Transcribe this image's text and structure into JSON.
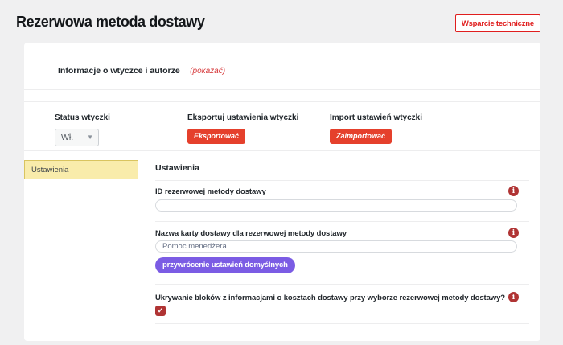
{
  "page": {
    "title": "Rezerwowa metoda dostawy",
    "support_button_label": "Wsparcie techniczne"
  },
  "info_section": {
    "label": "Informacje o wtyczce i autorze",
    "toggle_link_label": "(pokazać)"
  },
  "status_section": {
    "status_label": "Status wtyczki",
    "status_value": "Wł.",
    "export_label": "Eksportuj ustawienia wtyczki",
    "export_button_label": "Eksportować",
    "import_label": "Import ustawień wtyczki",
    "import_button_label": "Zaimportować"
  },
  "sidebar": {
    "tabs": [
      {
        "label": "Ustawienia",
        "active": true
      }
    ]
  },
  "settings_panel": {
    "heading": "Ustawienia",
    "fields": [
      {
        "type": "text",
        "label": "ID rezerwowej metody dostawy",
        "value": ""
      },
      {
        "type": "text",
        "label": "Nazwa karty dostawy dla rezerwowej metody dostawy",
        "value": "Pomoc menedżera",
        "reset_button_label": "przywrócenie ustawień domyślnych"
      },
      {
        "type": "checkbox",
        "label": "Ukrywanie bloków z informacjami o kosztach dostawy przy wyborze rezerwowej metody dostawy?",
        "checked": true
      }
    ]
  },
  "icons": {
    "info": "i",
    "check": "✓",
    "dropdown_arrow": "▼"
  },
  "colors": {
    "page_background": "#f0f0f1",
    "card_background": "#ffffff",
    "accent_action_red": "#e5402c",
    "support_outline_red": "#e01e1e",
    "info_icon_red": "#b03434",
    "checkbox_red": "#b03434",
    "purple_button": "#7b5ce4",
    "active_tab_yellow_bg": "#f9ecab",
    "active_tab_yellow_border": "#d9c45f",
    "link_red": "#d63638"
  }
}
